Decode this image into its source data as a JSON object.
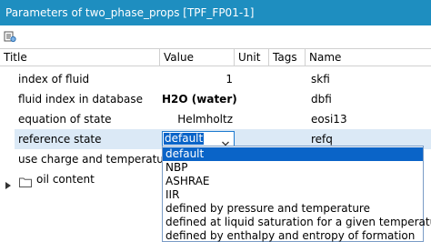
{
  "window": {
    "title": "Parameters of two_phase_props [TPF_FP01-1]"
  },
  "toolbar": {
    "icon": "parameters-icon"
  },
  "columns": {
    "title": "Title",
    "value": "Value",
    "unit": "Unit",
    "tags": "Tags",
    "name": "Name"
  },
  "rows": [
    {
      "title": "index of fluid",
      "value": "1",
      "name": "skfi"
    },
    {
      "title": "fluid index in database",
      "value": "H2O (water)",
      "name": "dbfi"
    },
    {
      "title": "equation of state",
      "value": "Helmholtz",
      "name": "eosi13"
    },
    {
      "title": "reference state",
      "value": "default",
      "name": "refq"
    },
    {
      "title": "use charge and temperature",
      "value": "",
      "name": ""
    },
    {
      "title": "oil content",
      "value": "",
      "name": ""
    }
  ],
  "dropdown": {
    "selected": "default",
    "options": [
      "default",
      "NBP",
      "ASHRAE",
      "IIR",
      "defined by pressure and temperature",
      "defined at liquid saturation for a given temperature",
      "defined by enthalpy and entropy of formation"
    ]
  },
  "colors": {
    "titlebar": "#1e8ec0",
    "selection": "#0a64c8",
    "row_highlight": "#dbe9f6"
  }
}
